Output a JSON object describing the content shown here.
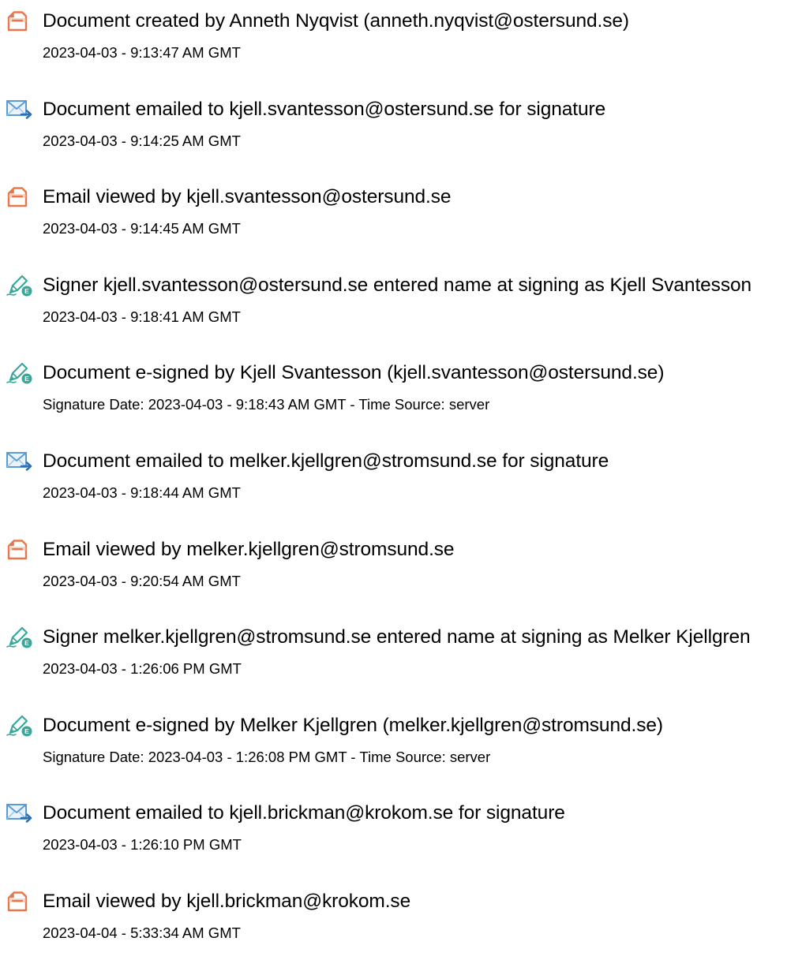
{
  "events": [
    {
      "icon": "document-created-icon",
      "title": "Document created by Anneth Nyqvist (anneth.nyqvist@ostersund.se)",
      "meta": "2023-04-03 - 9:13:47 AM GMT"
    },
    {
      "icon": "email-sent-icon",
      "title": "Document emailed to kjell.svantesson@ostersund.se for signature",
      "meta": "2023-04-03 - 9:14:25 AM GMT"
    },
    {
      "icon": "document-viewed-icon",
      "title": "Email viewed by kjell.svantesson@ostersund.se",
      "meta": "2023-04-03 - 9:14:45 AM GMT"
    },
    {
      "icon": "e-sign-icon",
      "title": "Signer kjell.svantesson@ostersund.se entered name at signing as Kjell Svantesson",
      "meta": "2023-04-03 - 9:18:41 AM GMT"
    },
    {
      "icon": "e-sign-icon",
      "title": "Document e-signed by Kjell Svantesson (kjell.svantesson@ostersund.se)",
      "meta": "Signature Date: 2023-04-03 - 9:18:43 AM GMT - Time Source: server"
    },
    {
      "icon": "email-sent-icon",
      "title": "Document emailed to melker.kjellgren@stromsund.se for signature",
      "meta": "2023-04-03 - 9:18:44 AM GMT"
    },
    {
      "icon": "document-viewed-icon",
      "title": "Email viewed by melker.kjellgren@stromsund.se",
      "meta": "2023-04-03 - 9:20:54 AM GMT"
    },
    {
      "icon": "e-sign-icon",
      "title": "Signer melker.kjellgren@stromsund.se entered name at signing as Melker Kjellgren",
      "meta": "2023-04-03 - 1:26:06 PM GMT"
    },
    {
      "icon": "e-sign-icon",
      "title": "Document e-signed by Melker Kjellgren (melker.kjellgren@stromsund.se)",
      "meta": "Signature Date: 2023-04-03 - 1:26:08 PM GMT - Time Source: server"
    },
    {
      "icon": "email-sent-icon",
      "title": "Document emailed to kjell.brickman@krokom.se for signature",
      "meta": "2023-04-03 - 1:26:10 PM GMT"
    },
    {
      "icon": "document-viewed-icon",
      "title": "Email viewed by kjell.brickman@krokom.se",
      "meta": "2023-04-04 - 5:33:34 AM GMT"
    }
  ],
  "colors": {
    "document_icon": "#e8754b",
    "email_icon": "#5b9bd5",
    "sign_icon": "#3aa79a",
    "text": "#000000"
  }
}
